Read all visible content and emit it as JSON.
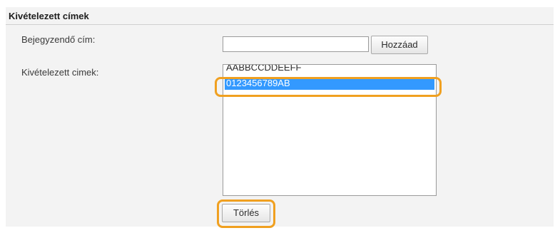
{
  "section": {
    "title": "Kivételezett címek"
  },
  "form": {
    "address_label": "Bejegyzendő cím:",
    "address_value": "",
    "add_button": "Hozzáad",
    "list_label": "Kivételezett cimek:",
    "list_items": [
      {
        "text": "AABBCCDDEEFF",
        "selected": false
      },
      {
        "text": "0123456789AB",
        "selected": true
      }
    ],
    "delete_button": "Törlés"
  },
  "colors": {
    "highlight": "#f0a020",
    "selection": "#3399ff",
    "panel_bg": "#f3f3f3"
  }
}
